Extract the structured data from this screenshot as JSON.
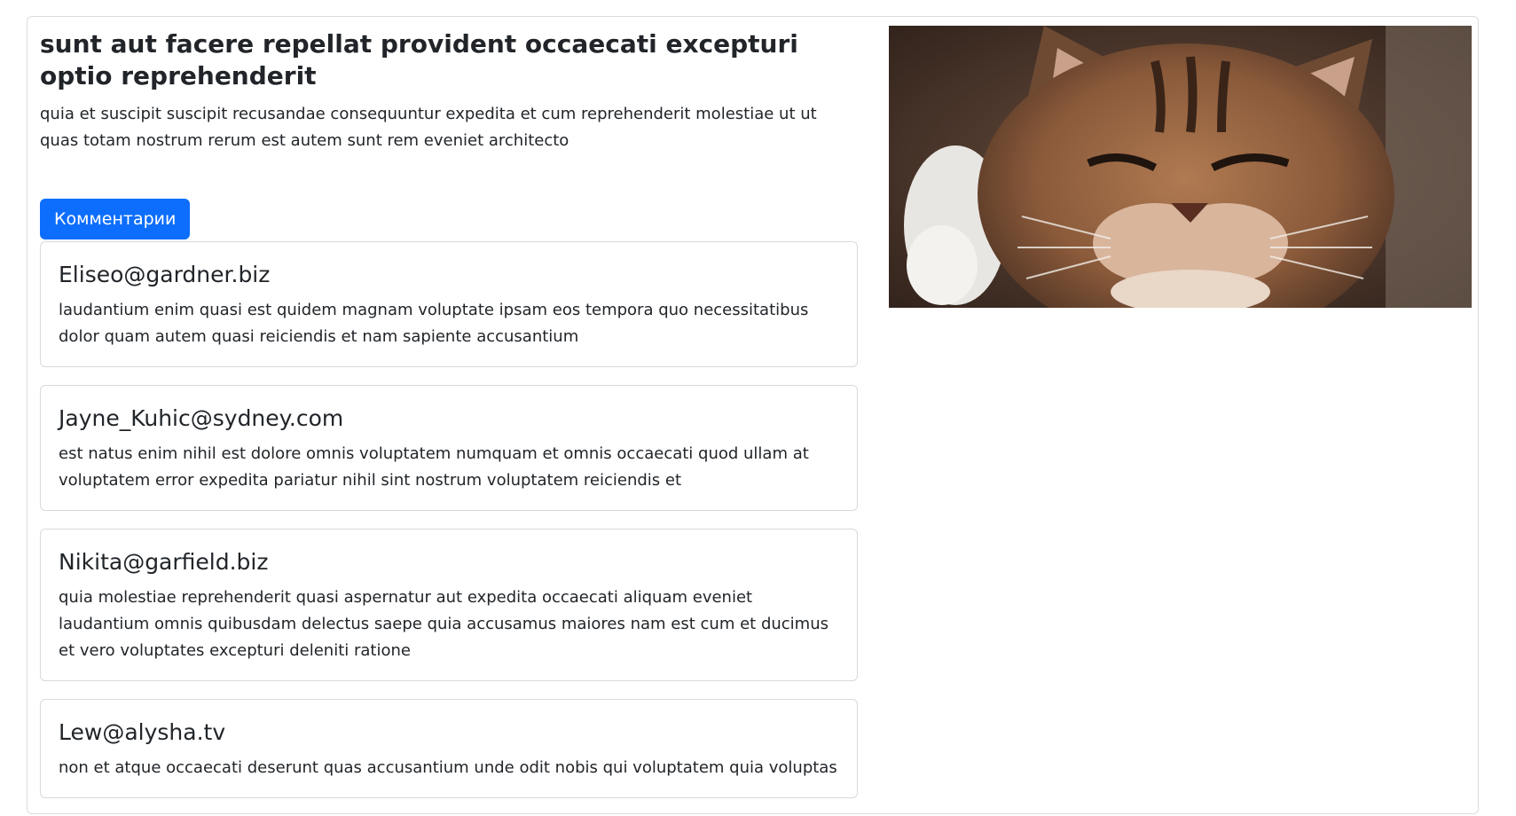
{
  "post": {
    "title": "sunt aut facere repellat provident occaecati excepturi optio reprehenderit",
    "body": "quia et suscipit suscipit recusandae consequuntur expedita et cum reprehenderit molestiae ut ut quas totam nostrum rerum est autem sunt rem eveniet architecto"
  },
  "comments_button_label": "Комментарии",
  "comments": [
    {
      "email": "Eliseo@gardner.biz",
      "body": "laudantium enim quasi est quidem magnam voluptate ipsam eos tempora quo necessitatibus dolor quam autem quasi reiciendis et nam sapiente accusantium"
    },
    {
      "email": "Jayne_Kuhic@sydney.com",
      "body": "est natus enim nihil est dolore omnis voluptatem numquam et omnis occaecati quod ullam at voluptatem error expedita pariatur nihil sint nostrum voluptatem reiciendis et"
    },
    {
      "email": "Nikita@garfield.biz",
      "body": "quia molestiae reprehenderit quasi aspernatur aut expedita occaecati aliquam eveniet laudantium omnis quibusdam delectus saepe quia accusamus maiores nam est cum et ducimus et vero voluptates excepturi deleniti ratione"
    },
    {
      "email": "Lew@alysha.tv",
      "body": "non et atque occaecati deserunt quas accusantium unde odit nobis qui voluptatem quia voluptas"
    }
  ],
  "colors": {
    "primary": "#0d6efd",
    "text": "#212529",
    "border": "#d9d9d9"
  },
  "image": {
    "subject": "cat-photo"
  }
}
